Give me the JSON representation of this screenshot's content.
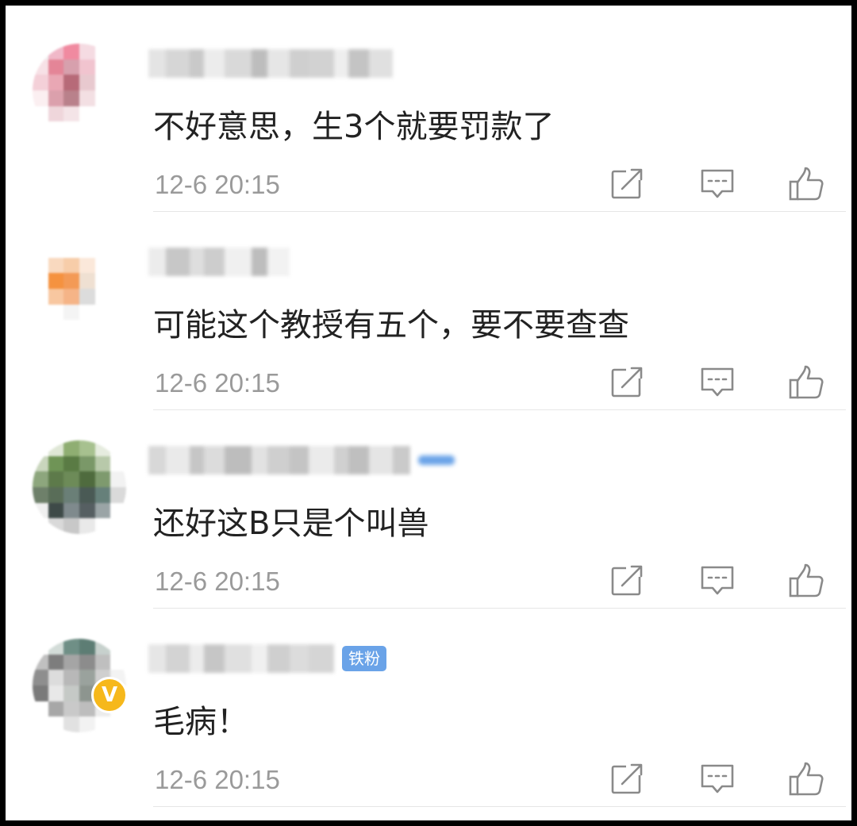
{
  "comments": [
    {
      "text": "不好意思，生3个就要罚款了",
      "time": "12-6 20:15",
      "avatar_colors": [
        "#f0f0f0",
        "#f0b8c8",
        "#f08aa0",
        "#f5dbe2",
        "#ffffff",
        "#ffffff",
        "#f7e1e6",
        "#e48597",
        "#d7a0ad",
        "#f1c4cf",
        "#ffffff",
        "#ffffff",
        "#f4d0d8",
        "#e9a7b4",
        "#b76a78",
        "#e8c9cf",
        "#ffffff",
        "#ffffff",
        "#fbeff1",
        "#dba0ac",
        "#b9818b",
        "#f3dfe3",
        "#ffffff",
        "#ffffff",
        "#ffffff",
        "#efd6db",
        "#f4e4e7",
        "#ffffff",
        "#ffffff",
        "#ffffff",
        "#ffffff",
        "#ffffff",
        "#ffffff",
        "#ffffff",
        "#ffffff",
        "#ffffff"
      ],
      "name_colors": [
        "#e4e4e4",
        "#d6d6d6",
        "#c9c9c9",
        "#ececec",
        "#d9d9d9",
        "#bdbdbd",
        "#e6e6e6",
        "#cfcfcf",
        "#d2d2d2",
        "#eeeeee",
        "#c4c4c4",
        "#e0e0e0"
      ],
      "badge": "",
      "verified": false
    },
    {
      "text": "可能这个教授有五个，要不要查查",
      "time": "12-6 20:15",
      "avatar_colors": [
        "#ffffff",
        "#ffffff",
        "#ffffff",
        "#ffffff",
        "#ffffff",
        "#ffffff",
        "#ffffff",
        "#f9d9bf",
        "#f7cda9",
        "#fbe8da",
        "#ffffff",
        "#ffffff",
        "#ffffff",
        "#f5923f",
        "#f39a56",
        "#efe0d2",
        "#ffffff",
        "#ffffff",
        "#ffffff",
        "#f8c7a0",
        "#f5b487",
        "#dcdcdc",
        "#ffffff",
        "#ffffff",
        "#ffffff",
        "#ffffff",
        "#f4f4f4",
        "#ffffff",
        "#ffffff",
        "#ffffff",
        "#ffffff",
        "#ffffff",
        "#ffffff",
        "#ffffff",
        "#ffffff",
        "#ffffff"
      ],
      "name_colors": [
        "#ececec",
        "#c7c7c7",
        "#dedede",
        "#cdcdcd",
        "#f0f0f0",
        "#bdbdbd",
        "#f2f2f2"
      ],
      "badge": "",
      "verified": false
    },
    {
      "text": "还好这B只是个叫兽",
      "time": "12-6 20:15",
      "avatar_colors": [
        "#ffffff",
        "#dfe7d6",
        "#8fae72",
        "#a7c18f",
        "#e6ecdf",
        "#ffffff",
        "#c9d6bd",
        "#6f9456",
        "#5a7b44",
        "#7a9868",
        "#b8c9aa",
        "#ffffff",
        "#8da67d",
        "#5d7a4a",
        "#6d8b58",
        "#4f6b3e",
        "#7e9a6e",
        "#f2f2f2",
        "#6e806a",
        "#596d58",
        "#6a7f77",
        "#4a5a55",
        "#66807a",
        "#dadada",
        "#f0f0f0",
        "#3e4a48",
        "#7f8a8d",
        "#565f62",
        "#9aa4a6",
        "#ffffff",
        "#ffffff",
        "#d9d9d9",
        "#c8c8c8",
        "#e9e9e9",
        "#ffffff",
        "#ffffff"
      ],
      "name_colors": [
        "#d8d8d8",
        "#eaeaea",
        "#c6c6c6",
        "#dcdcdc",
        "#bdbdbd",
        "#e2e2e2",
        "#cfcfcf",
        "#c4c4c4",
        "#ebebeb",
        "#d0d0d0",
        "#bfbfbf",
        "#e5e5e5",
        "#cacaca"
      ],
      "badge": "",
      "verified": false
    },
    {
      "text": "毛病！",
      "time": "12-6 20:15",
      "avatar_colors": [
        "#ffffff",
        "#d3dcd8",
        "#6f8f86",
        "#5d7d74",
        "#c7d1cd",
        "#ffffff",
        "#c0c0c0",
        "#7d7d7d",
        "#a5a5a5",
        "#8c8c8c",
        "#bfbfbf",
        "#ffffff",
        "#8e8e8e",
        "#dcdcdc",
        "#b8b8b8",
        "#9aa29d",
        "#cfcfcf",
        "#f3f3f3",
        "#7a7a7a",
        "#e8e8e8",
        "#c5c9c6",
        "#8d958f",
        "#d8d8d8",
        "#ffffff",
        "#ffffff",
        "#a7a7a7",
        "#c9c9c9",
        "#bdbdbd",
        "#ececec",
        "#ffffff",
        "#ffffff",
        "#ffffff",
        "#e1e1e1",
        "#f2f2f2",
        "#ffffff",
        "#ffffff"
      ],
      "name_colors": [
        "#e6e6e6",
        "#d3d3d3",
        "#ececec",
        "#c6c6c6",
        "#e0e0e0",
        "#f0f0f0",
        "#cfcfcf",
        "#dcdcdc",
        "#d5d5d5"
      ],
      "badge": "铁粉",
      "verified": true
    }
  ],
  "icons": {
    "repost": "repost-icon",
    "reply": "reply-icon",
    "like": "like-icon",
    "verified": "verified-badge-icon"
  },
  "colors": {
    "text": "#222222",
    "time": "#9a9a9a",
    "icon": "#8a8a8a",
    "badge": "#6aa3e8",
    "verified": "#f6b81b"
  }
}
